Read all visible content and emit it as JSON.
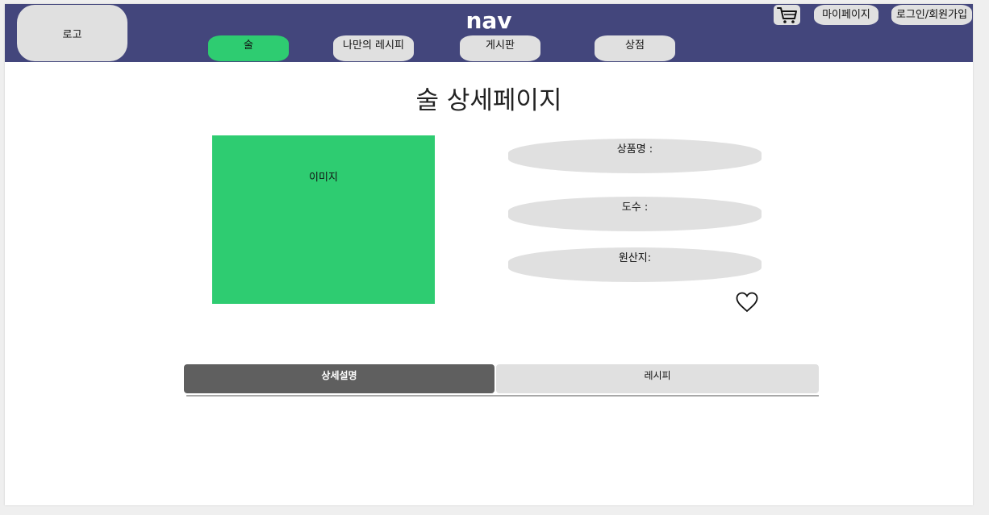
{
  "nav": {
    "logo": "로고",
    "title": "nav",
    "menu": [
      {
        "label": "술",
        "active": true
      },
      {
        "label": "나만의 레시피",
        "active": false
      },
      {
        "label": "게시판",
        "active": false
      },
      {
        "label": "상점",
        "active": false
      }
    ],
    "cart_icon": "cart-icon",
    "mypage": "마이페이지",
    "login": "로그인/회원가입"
  },
  "main": {
    "heading": "술 상세페이지",
    "image_label": "이미지",
    "fields": {
      "name": "상품명 :",
      "abv": "도수 :",
      "origin": "원산지:"
    },
    "heart_icon": "heart-icon"
  },
  "tabs": {
    "detail": "상세설명",
    "recipe": "레시피",
    "active": "detail"
  },
  "colors": {
    "nav_bg": "#43467c",
    "accent": "#2ecc71",
    "pill_bg": "#e0e0e0",
    "active_tab": "#5f5f5f"
  }
}
